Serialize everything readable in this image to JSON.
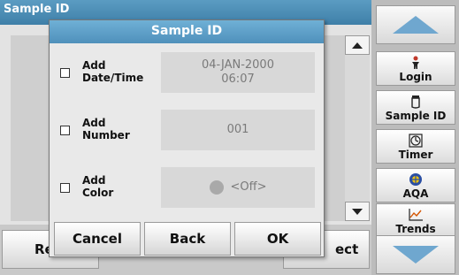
{
  "background": {
    "title": "Sample ID",
    "left_button": "Re",
    "right_button": "ect"
  },
  "sidebar": {
    "items": [
      {
        "label": "Login",
        "icon": "login-icon"
      },
      {
        "label": "Sample ID",
        "icon": "sample-id-icon"
      },
      {
        "label": "Timer",
        "icon": "timer-icon"
      },
      {
        "label": "AQA",
        "icon": "aqa-icon"
      },
      {
        "label": "Trends",
        "icon": "trends-icon"
      }
    ],
    "accent_color": "#6fa7cf"
  },
  "dialog": {
    "title": "Sample ID",
    "rows": [
      {
        "label_line1": "Add",
        "label_line2": "Date/Time",
        "value_line1": "04-JAN-2000",
        "value_line2": "06:07",
        "checked": false
      },
      {
        "label_line1": "Add",
        "label_line2": "Number",
        "value_line1": "001",
        "checked": false
      },
      {
        "label_line1": "Add",
        "label_line2": "Color",
        "value_line1": "<Off>",
        "checked": false
      }
    ],
    "buttons": {
      "cancel": "Cancel",
      "back": "Back",
      "ok": "OK"
    }
  }
}
